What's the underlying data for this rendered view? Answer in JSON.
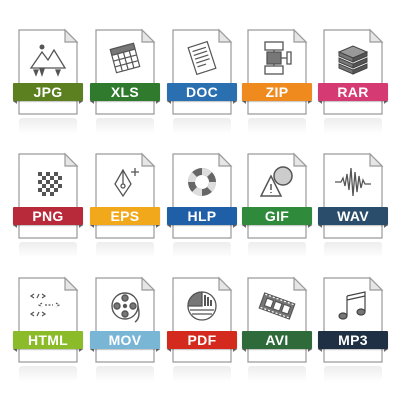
{
  "files": [
    {
      "label": "JPG",
      "color": "#5c7f20",
      "icon": "image-icon"
    },
    {
      "label": "XLS",
      "color": "#2f7a2c",
      "icon": "spreadsheet-icon"
    },
    {
      "label": "DOC",
      "color": "#2a6fb0",
      "icon": "document-icon"
    },
    {
      "label": "ZIP",
      "color": "#ee8a1e",
      "icon": "archive-icon"
    },
    {
      "label": "RAR",
      "color": "#d63a72",
      "icon": "books-icon"
    },
    {
      "label": "PNG",
      "color": "#b82a3a",
      "icon": "checkerboard-icon"
    },
    {
      "label": "EPS",
      "color": "#f2a81b",
      "icon": "pen-tool-icon"
    },
    {
      "label": "HLP",
      "color": "#1f5fa8",
      "icon": "lifebuoy-icon"
    },
    {
      "label": "GIF",
      "color": "#2f8a3c",
      "icon": "shapes-icon"
    },
    {
      "label": "WAV",
      "color": "#2a4d6b",
      "icon": "waveform-icon"
    },
    {
      "label": "HTML",
      "color": "#8cbb2a",
      "icon": "code-icon"
    },
    {
      "label": "MOV",
      "color": "#79b6d6",
      "icon": "film-reel-icon"
    },
    {
      "label": "PDF",
      "color": "#d42a1e",
      "icon": "pdf-chart-icon"
    },
    {
      "label": "AVI",
      "color": "#2f6a3a",
      "icon": "film-strip-icon"
    },
    {
      "label": "MP3",
      "color": "#1f2f44",
      "icon": "music-note-icon"
    }
  ]
}
